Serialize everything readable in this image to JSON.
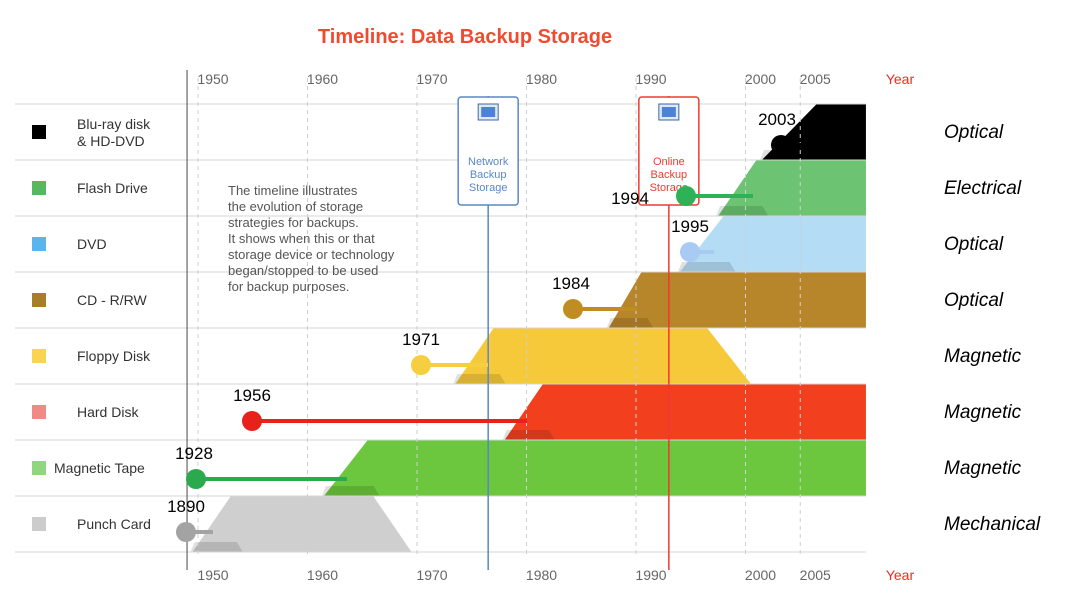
{
  "chart_data": {
    "type": "area",
    "title": "Timeline: Data Backup Storage",
    "x_axis_label": "Year",
    "x_ticks": [
      1950,
      1960,
      1970,
      1980,
      1990,
      2000,
      2005
    ],
    "xlim": [
      1949,
      2011
    ],
    "annotation_text": [
      "The timeline illustrates",
      "the evolution of storage",
      "strategies for backups.",
      "It shows when this or that",
      "storage device or technology",
      "began/stopped to be used",
      "for backup purposes."
    ],
    "markers": [
      {
        "label": [
          "Network",
          "Backup",
          "Storage"
        ],
        "year": 1976.5,
        "color": "#5a86c8"
      },
      {
        "label": [
          "Online",
          "Backup",
          "Storage"
        ],
        "year": 1993,
        "color": "#ee3a30"
      }
    ],
    "series": [
      {
        "name": "Blu-ray disk & HD-DVD",
        "name_lines": [
          "Blu-ray disk",
          "& HD-DVD"
        ],
        "category": "Optical",
        "invented": 2003,
        "color": "#000000",
        "legend_color": "#000000",
        "shape": {
          "start_low": 2001.5,
          "start_high": 2006.5,
          "end_high": 2011,
          "end_low": 2011
        }
      },
      {
        "name": "Flash Drive",
        "name_lines": [
          "Flash Drive"
        ],
        "category": "Electrical",
        "invented": 1994,
        "color": "#6cc472",
        "legend_color": "#57b860",
        "shape": {
          "start_low": 1997.5,
          "start_high": 2001,
          "end_high": 2011,
          "end_low": 2011
        }
      },
      {
        "name": "DVD",
        "name_lines": [
          "DVD"
        ],
        "category": "Optical",
        "invented": 1995,
        "color": "#b5dcf5",
        "legend_color": "#5ab4ee",
        "shape": {
          "start_low": 1994,
          "start_high": 1998,
          "end_high": 2011,
          "end_low": 2011
        }
      },
      {
        "name": "CD - R/RW",
        "name_lines": [
          "CD - R/RW"
        ],
        "category": "Optical",
        "invented": 1984,
        "color": "#b8862a",
        "legend_color": "#a97e28",
        "shape": {
          "start_low": 1987.5,
          "start_high": 1990.5,
          "end_high": 2011,
          "end_low": 2011
        }
      },
      {
        "name": "Floppy Disk",
        "name_lines": [
          "Floppy Disk"
        ],
        "category": "Magnetic",
        "invented": 1971,
        "color": "#f6c93a",
        "legend_color": "#f8d450",
        "shape": {
          "start_low": 1973.5,
          "start_high": 1977,
          "end_high": 1996.5,
          "end_low": 2000.5
        }
      },
      {
        "name": "Hard Disk",
        "name_lines": [
          "Hard Disk"
        ],
        "category": "Magnetic",
        "invented": 1956,
        "color": "#f2401e",
        "legend_color": "#f08a85",
        "shape": {
          "start_low": 1978,
          "start_high": 1981.5,
          "end_high": 2011,
          "end_low": 2011
        }
      },
      {
        "name": "Magnetic Tape",
        "name_lines": [
          "Magnetic Tape"
        ],
        "category": "Magnetic",
        "invented": 1928,
        "color": "#6cc73e",
        "legend_color": "#8fd67e",
        "shape": {
          "start_low": 1961.5,
          "start_high": 1965.5,
          "end_high": 2011,
          "end_low": 2011
        }
      },
      {
        "name": "Punch Card",
        "name_lines": [
          "Punch Card"
        ],
        "category": "Mechanical",
        "invented": 1890,
        "color": "#cfcfcf",
        "legend_color": "#cccccc",
        "shape": {
          "start_low": 1949.5,
          "start_high": 1953,
          "end_high": 1966,
          "end_low": 1969.5
        }
      }
    ],
    "dot_colors": {
      "Blu-ray disk & HD-DVD": "#000000",
      "Flash Drive": "#2db257",
      "DVD": "#a9cbf3",
      "CD - R/RW": "#c08d22",
      "Floppy Disk": "#f5cf3f",
      "Hard Disk": "#e8211c",
      "Magnetic Tape": "#2aaa4c",
      "Punch Card": "#a3a3a3"
    },
    "year_label_color": "#ef2b22",
    "title_color": "#ef4b30"
  }
}
